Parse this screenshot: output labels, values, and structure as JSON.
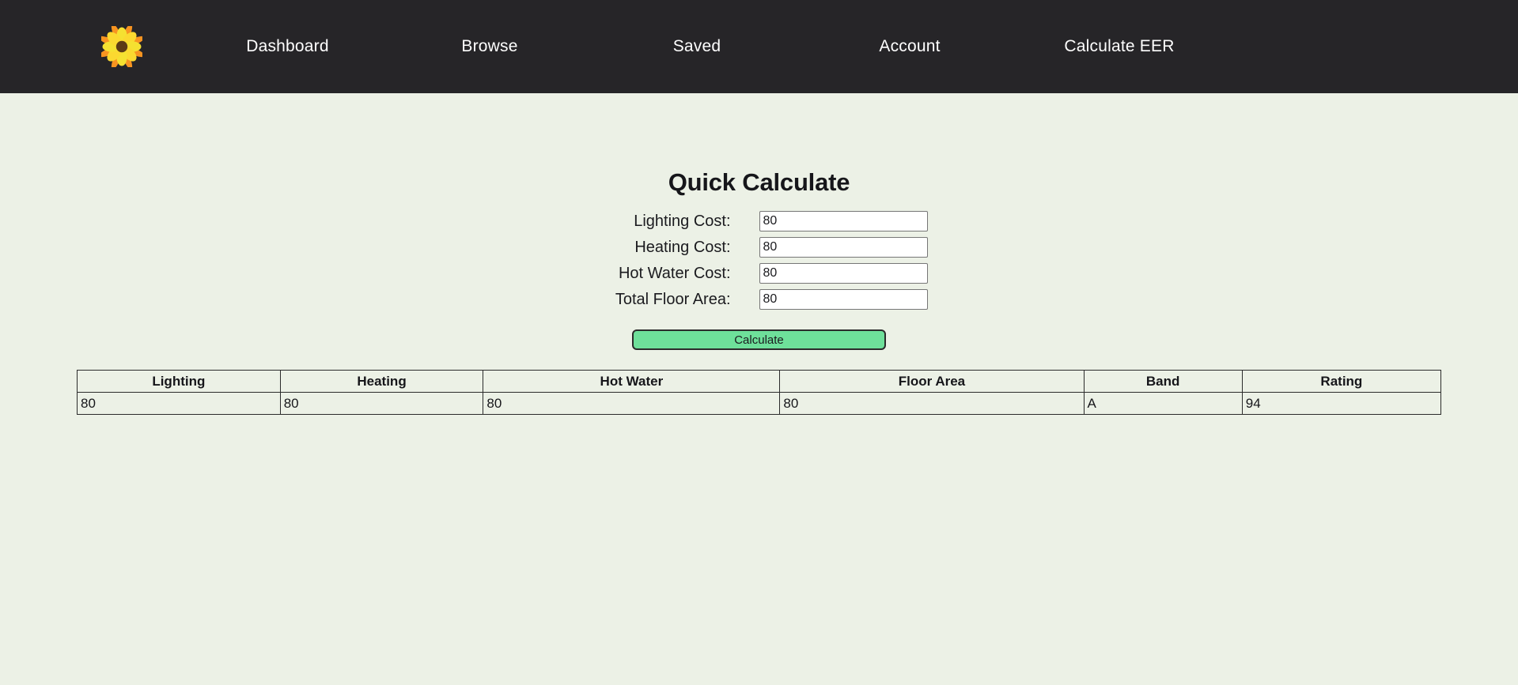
{
  "theme": {
    "header_bg": "#262528",
    "page_bg": "#ecf1e6",
    "text": "#1b1b1f",
    "button_green": "#6ee09a",
    "border": "#2b2b2b",
    "input_border": "#767676"
  },
  "header": {
    "logo_icon": "blossom-flower-icon",
    "nav": [
      {
        "label": "Dashboard"
      },
      {
        "label": "Browse"
      },
      {
        "label": "Saved"
      },
      {
        "label": "Account"
      },
      {
        "label": "Calculate EER"
      }
    ]
  },
  "main": {
    "title": "Quick Calculate",
    "form": {
      "fields": [
        {
          "label": "Lighting Cost:",
          "value": "80",
          "placeholder": ""
        },
        {
          "label": "Heating Cost:",
          "value": "80",
          "placeholder": ""
        },
        {
          "label": "Hot Water Cost:",
          "value": "80",
          "placeholder": ""
        },
        {
          "label": "Total Floor Area:",
          "value": "80",
          "placeholder": ""
        }
      ],
      "submit_label": "Calculate"
    },
    "results_table": {
      "headers": [
        "Lighting",
        "Heating",
        "Hot Water",
        "Floor Area",
        "Band",
        "Rating"
      ],
      "rows": [
        [
          "80",
          "80",
          "80",
          "80",
          "A",
          "94"
        ]
      ]
    }
  }
}
